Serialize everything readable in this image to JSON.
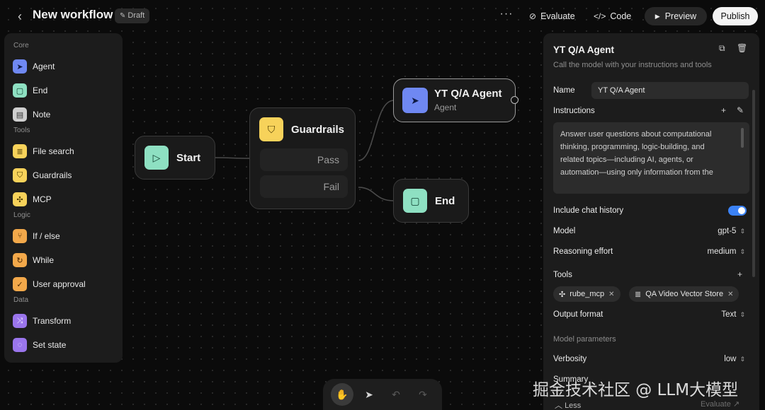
{
  "app": {
    "title": "New workflow",
    "status_badge": "Draft",
    "actions": {
      "evaluate": "Evaluate",
      "code": "Code",
      "preview": "Preview",
      "publish": "Publish"
    }
  },
  "palette": {
    "sections": [
      {
        "label": "Core",
        "items": [
          {
            "label": "Agent",
            "icon": "agent-arrow-icon",
            "color": "#6f88f2"
          },
          {
            "label": "End",
            "icon": "stop-square-icon",
            "color": "#8ee0c2"
          },
          {
            "label": "Note",
            "icon": "sticky-note-icon",
            "color": "#cfcfcf"
          }
        ]
      },
      {
        "label": "Tools",
        "items": [
          {
            "label": "File search",
            "icon": "database-icon",
            "color": "#f7d25a"
          },
          {
            "label": "Guardrails",
            "icon": "shield-icon",
            "color": "#f7d25a"
          },
          {
            "label": "MCP",
            "icon": "mcp-icon",
            "color": "#f7d25a"
          }
        ]
      },
      {
        "label": "Logic",
        "items": [
          {
            "label": "If / else",
            "icon": "branch-icon",
            "color": "#f2a84a"
          },
          {
            "label": "While",
            "icon": "loop-icon",
            "color": "#f2a84a"
          },
          {
            "label": "User approval",
            "icon": "approval-icon",
            "color": "#f2a84a"
          }
        ]
      },
      {
        "label": "Data",
        "items": [
          {
            "label": "Transform",
            "icon": "shuffle-icon",
            "color": "#9a75ec"
          },
          {
            "label": "Set state",
            "icon": "state-icon",
            "color": "#9a75ec"
          }
        ]
      }
    ]
  },
  "canvas": {
    "nodes": {
      "start": {
        "title": "Start"
      },
      "guardrails": {
        "title": "Guardrails",
        "branches": [
          "Pass",
          "Fail"
        ]
      },
      "agent": {
        "title": "YT Q/A Agent",
        "subtitle": "Agent"
      },
      "end": {
        "title": "End"
      }
    }
  },
  "panel": {
    "title": "YT Q/A Agent",
    "description": "Call the model with your instructions and tools",
    "name_label": "Name",
    "name_value": "YT Q/A Agent",
    "instructions_label": "Instructions",
    "instructions_lines": [
      "Answer user questions about computational",
      "thinking, programming, logic-building, and",
      "related topics—including AI, agents, or",
      "automation—using only information from the"
    ],
    "chat_history_label": "Include chat history",
    "chat_history_enabled": true,
    "model_label": "Model",
    "model_value": "gpt-5",
    "reasoning_label": "Reasoning effort",
    "reasoning_value": "medium",
    "tools_label": "Tools",
    "tools": [
      {
        "label": "rube_mcp",
        "icon": "mcp-icon"
      },
      {
        "label": "QA Video Vector Store",
        "icon": "database-icon"
      }
    ],
    "output_label": "Output format",
    "output_value": "Text",
    "params_heading": "Model parameters",
    "verbosity_label": "Verbosity",
    "verbosity_value": "low",
    "summary_label": "Summary",
    "less_label": "Less",
    "evaluate_label": "Evaluate"
  },
  "watermark": "掘金技术社区 @ LLM大模型",
  "colors": {
    "accent_toggle": "#3b82f6",
    "agent": "#6f88f2",
    "tool": "#f7d25a",
    "logic": "#f2a84a",
    "data": "#9a75ec",
    "end": "#8ee0c2"
  }
}
